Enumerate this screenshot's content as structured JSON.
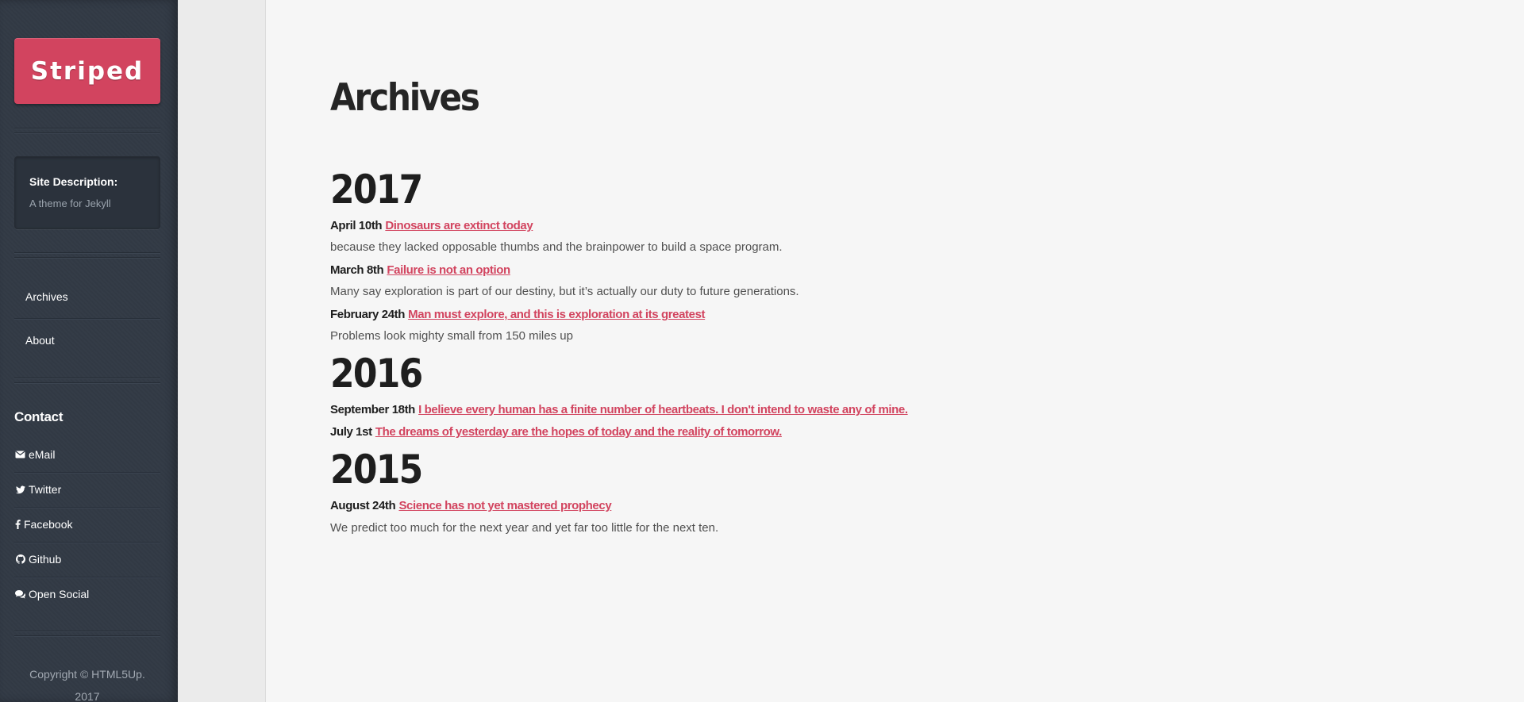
{
  "sidebar": {
    "logo": "Striped",
    "description_title": "Site Description:",
    "description_text": "A theme for Jekyll",
    "nav": [
      {
        "label": "Archives"
      },
      {
        "label": "About"
      }
    ],
    "contact_heading": "Contact",
    "contacts": [
      {
        "label": "eMail",
        "icon": "envelope-icon"
      },
      {
        "label": "Twitter",
        "icon": "twitter-icon"
      },
      {
        "label": "Facebook",
        "icon": "facebook-icon"
      },
      {
        "label": "Github",
        "icon": "github-icon"
      },
      {
        "label": "Open Social",
        "icon": "comments-icon"
      }
    ],
    "copyright_line1": "Copyright © HTML5Up.",
    "copyright_line2": "2017"
  },
  "main": {
    "title": "Archives",
    "years": [
      {
        "year": "2017",
        "posts": [
          {
            "date": "April 10th",
            "title": "Dinosaurs are extinct today",
            "excerpt": "because they lacked opposable thumbs and the brainpower to build a space program."
          },
          {
            "date": "March 8th",
            "title": "Failure is not an option",
            "excerpt": "Many say exploration is part of our destiny, but it’s actually our duty to future generations."
          },
          {
            "date": "February 24th",
            "title": "Man must explore, and this is exploration at its greatest",
            "excerpt": "Problems look mighty small from 150 miles up"
          }
        ]
      },
      {
        "year": "2016",
        "posts": [
          {
            "date": "September 18th",
            "title": "I believe every human has a finite number of heartbeats. I don't intend to waste any of mine."
          },
          {
            "date": "July 1st",
            "title": "The dreams of yesterday are the hopes of today and the reality of tomorrow."
          }
        ]
      },
      {
        "year": "2015",
        "posts": [
          {
            "date": "August 24th",
            "title": "Science has not yet mastered prophecy",
            "excerpt": "We predict too much for the next year and yet far too little for the next ten."
          }
        ]
      }
    ]
  },
  "colors": {
    "accent": "#d2445f",
    "sidebar": "#323a45",
    "content_bg": "#f6f6f6"
  }
}
